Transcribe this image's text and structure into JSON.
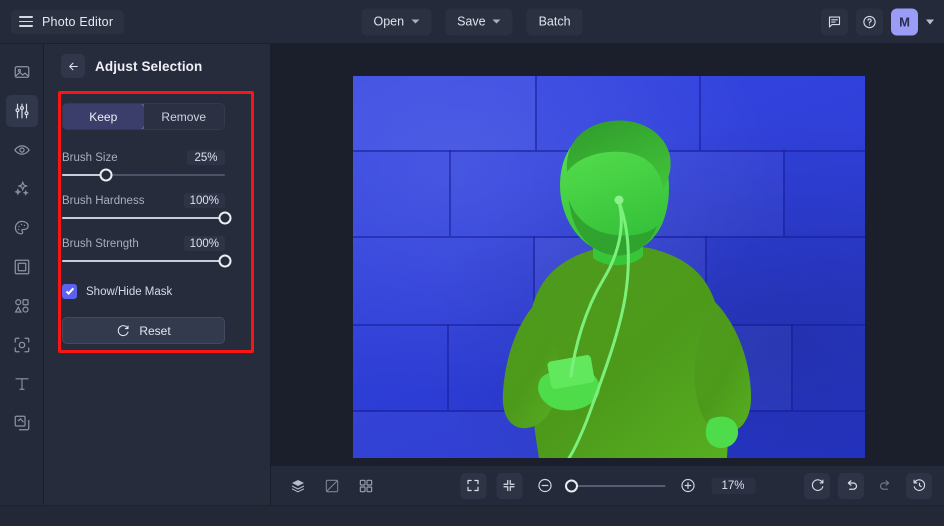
{
  "app": {
    "brand": "Photo Editor",
    "menu_icon": "hamburger-icon"
  },
  "topbar": {
    "open_label": "Open",
    "save_label": "Save",
    "batch_label": "Batch",
    "feedback_icon": "comment-icon",
    "help_icon": "question-circle-icon",
    "avatar_initial": "M"
  },
  "rail": {
    "items": [
      {
        "name": "image",
        "icon": "image-icon",
        "active": false
      },
      {
        "name": "adjust",
        "icon": "sliders-icon",
        "active": true
      },
      {
        "name": "retouch",
        "icon": "eye-icon",
        "active": false
      },
      {
        "name": "effects",
        "icon": "sparkles-icon",
        "active": false
      },
      {
        "name": "color",
        "icon": "palette-icon",
        "active": false
      },
      {
        "name": "frames",
        "icon": "frame-icon",
        "active": false
      },
      {
        "name": "elements",
        "icon": "shapes-icon",
        "active": false
      },
      {
        "name": "cutout",
        "icon": "cutout-icon",
        "active": false
      },
      {
        "name": "text",
        "icon": "text-t-icon",
        "active": false
      },
      {
        "name": "layers",
        "icon": "layers-copy-icon",
        "active": false
      }
    ]
  },
  "panel": {
    "title": "Adjust Selection",
    "back_icon": "arrow-left-icon",
    "segments": [
      {
        "label": "Keep",
        "active": true
      },
      {
        "label": "Remove",
        "active": false
      }
    ],
    "sliders": [
      {
        "label": "Brush Size",
        "value": "25%",
        "percent": 27
      },
      {
        "label": "Brush Hardness",
        "value": "100%",
        "percent": 100
      },
      {
        "label": "Brush Strength",
        "value": "100%",
        "percent": 100
      }
    ],
    "checkbox": {
      "label": "Show/Hide Mask",
      "checked": true
    },
    "reset": {
      "label": "Reset",
      "icon": "refresh-icon"
    }
  },
  "canvas": {
    "mask_keep_color": "#3ecf3a",
    "mask_remove_color": "#2a3ce2",
    "subject_description": "man-with-earphones-holding-phone"
  },
  "bottombar": {
    "left_tools": [
      {
        "name": "layers",
        "icon": "layers-stack-icon"
      },
      {
        "name": "compare",
        "icon": "compare-split-icon"
      },
      {
        "name": "grid",
        "icon": "grid-four-icon"
      }
    ],
    "center_tools": [
      {
        "name": "fit-screen",
        "icon": "expand-corners-icon"
      },
      {
        "name": "actual-size",
        "icon": "collapse-corners-icon"
      },
      {
        "name": "zoom-out",
        "icon": "minus-circle-icon"
      }
    ],
    "zoom_value": "17%",
    "zoom_percent": 4,
    "zoom_in_icon": "plus-circle-icon",
    "right_tools": [
      {
        "name": "reset-view",
        "icon": "refresh-icon",
        "disabled": false
      },
      {
        "name": "undo",
        "icon": "undo-arrow-icon",
        "disabled": false
      },
      {
        "name": "redo",
        "icon": "redo-arrow-icon",
        "disabled": true
      },
      {
        "name": "history",
        "icon": "clock-history-icon",
        "disabled": false
      }
    ]
  },
  "annotation": {
    "highlight_color": "#fb1414"
  }
}
